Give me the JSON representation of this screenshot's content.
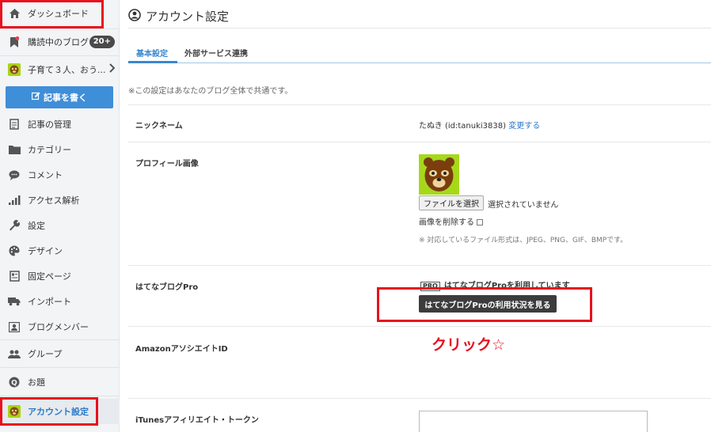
{
  "sidebar": {
    "items": [
      {
        "label": "ダッシュボード",
        "icon": "home-icon"
      },
      {
        "label": "購読中のブログ",
        "icon": "bookmark-icon",
        "badge": "20+"
      },
      {
        "label": "子育て３人、おう...",
        "icon": "blog-avatar"
      },
      {
        "label": "記事の管理",
        "icon": "document-icon"
      },
      {
        "label": "カテゴリー",
        "icon": "folder-icon"
      },
      {
        "label": "コメント",
        "icon": "comment-icon"
      },
      {
        "label": "アクセス解析",
        "icon": "bar-chart-icon"
      },
      {
        "label": "設定",
        "icon": "wrench-icon"
      },
      {
        "label": "デザイン",
        "icon": "palette-icon"
      },
      {
        "label": "固定ページ",
        "icon": "page-icon"
      },
      {
        "label": "インポート",
        "icon": "truck-icon"
      },
      {
        "label": "ブログメンバー",
        "icon": "member-icon"
      },
      {
        "label": "グループ",
        "icon": "group-icon"
      },
      {
        "label": "お題",
        "icon": "topic-icon"
      },
      {
        "label": "アカウント設定",
        "icon": "account-avatar"
      }
    ],
    "write_button": "記事を書く"
  },
  "main": {
    "title": "アカウント設定",
    "tabs": [
      "基本設定",
      "外部サービス連携"
    ],
    "note": "※この設定はあなたのブログ全体で共通です。",
    "nickname": {
      "label": "ニックネーム",
      "value": "たぬき (id:tanuki3838)",
      "change_link": "変更する"
    },
    "profile_image": {
      "label": "プロフィール画像",
      "file_button": "ファイルを選択",
      "file_status": "選択されていません",
      "delete_label": "画像を削除する",
      "formats_note": "※ 対応しているファイル形式は、JPEG、PNG、GIF、BMPです。"
    },
    "hatena_pro": {
      "label": "はてなブログPro",
      "tag": "PRO",
      "status": "はてなブログProを利用しています",
      "button": "はてなブログProの利用状況を見る"
    },
    "amazon": {
      "label": "AmazonアソシエイトID"
    },
    "itunes": {
      "label": "iTunesアフィリエイト・トークン"
    }
  },
  "annotation": "クリック☆",
  "colors": {
    "accent": "#3a87cf",
    "highlight": "#e8101e",
    "sidebar_bg": "#f3f4f6"
  }
}
